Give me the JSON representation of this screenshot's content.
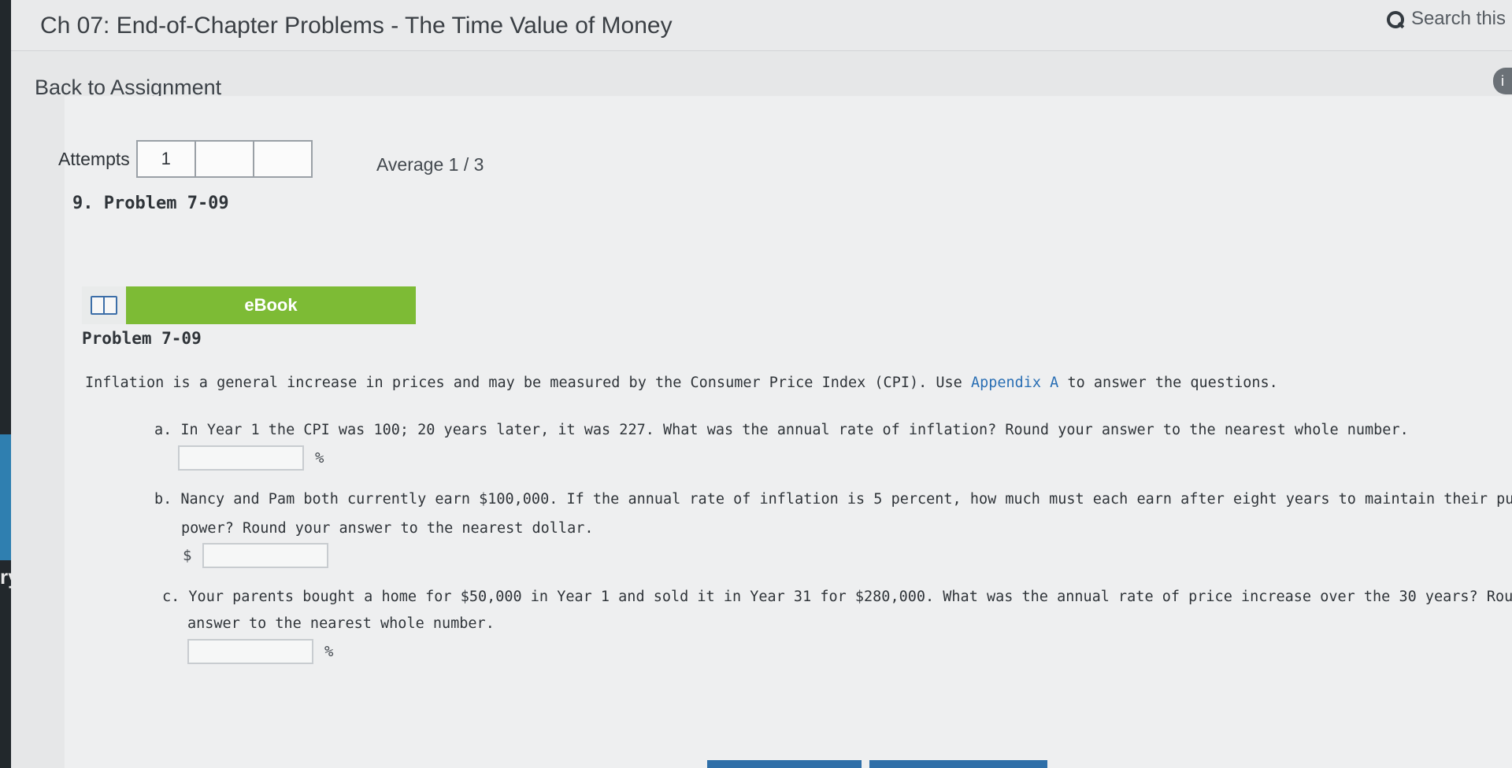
{
  "header": {
    "title": "Ch 07: End-of-Chapter Problems - The Time Value of Money",
    "search_label": "Search this"
  },
  "nav": {
    "back_label": "Back to Assignment",
    "sidebar_text": "ry"
  },
  "attempts": {
    "label": "Attempts",
    "boxes": [
      "1",
      "",
      ""
    ],
    "average_text": "Average 1 / 3"
  },
  "problem": {
    "number_title": "9. Problem 7-09",
    "ebook_label": "eBook",
    "heading": "Problem 7-09",
    "intro_text": "Inflation is a general increase in prices and may be measured by the Consumer Price Index (CPI). Use ",
    "appendix_link": "Appendix A",
    "intro_end": " to answer the questions.",
    "questions": {
      "a": {
        "text": "a. In Year 1 the CPI was 100; 20 years later, it was 227. What was the annual rate of inflation? Round your answer to the nearest whole number.",
        "unit": "%",
        "value": ""
      },
      "b": {
        "text": "b. Nancy and Pam both currently earn $100,000. If the annual rate of inflation is 5 percent, how much must each earn after eight years to maintain their purchasing",
        "text2": "power? Round your answer to the nearest dollar.",
        "unit": "$",
        "value": ""
      },
      "c": {
        "text": "c. Your parents bought a home for $50,000 in Year 1 and sold it in Year 31 for $280,000. What was the annual rate of price increase over the 30 years? Round your",
        "text2": "answer to the nearest whole number.",
        "unit": "%",
        "value": ""
      }
    }
  }
}
